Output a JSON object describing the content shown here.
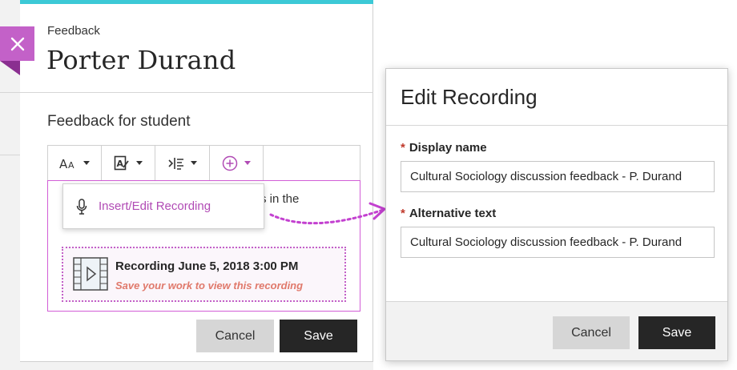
{
  "feedback_panel": {
    "breadcrumb": "Feedback",
    "student_name": "Porter Durand",
    "section_title": "Feedback for student",
    "editor": {
      "toolbar_icons": [
        "text-size-icon",
        "text-format-icon",
        "paragraph-icon",
        "insert-content-icon"
      ],
      "partial_text": "s in the",
      "insert_menu": {
        "item_icon": "microphone-icon",
        "item_label": "Insert/Edit Recording"
      },
      "recording": {
        "title": "Recording June 5, 2018 3:00 PM",
        "note": "Save your work to view this recording"
      }
    },
    "cancel_label": "Cancel",
    "save_label": "Save"
  },
  "edit_recording_dialog": {
    "title": "Edit Recording",
    "required_mark": "*",
    "display_name": {
      "label": "Display name",
      "value": "Cultural Sociology discussion feedback - P. Durand"
    },
    "alternative_text": {
      "label": "Alternative text",
      "value": "Cultural Sociology discussion feedback - P. Durand"
    },
    "cancel_label": "Cancel",
    "save_label": "Save"
  },
  "colors": {
    "accent_purple": "#c361c8",
    "accent_teal": "#3cc9d6",
    "primary_button": "#262626",
    "secondary_button": "#d6d6d6",
    "required_red": "#c0392b",
    "warning_text": "#e0796b"
  }
}
